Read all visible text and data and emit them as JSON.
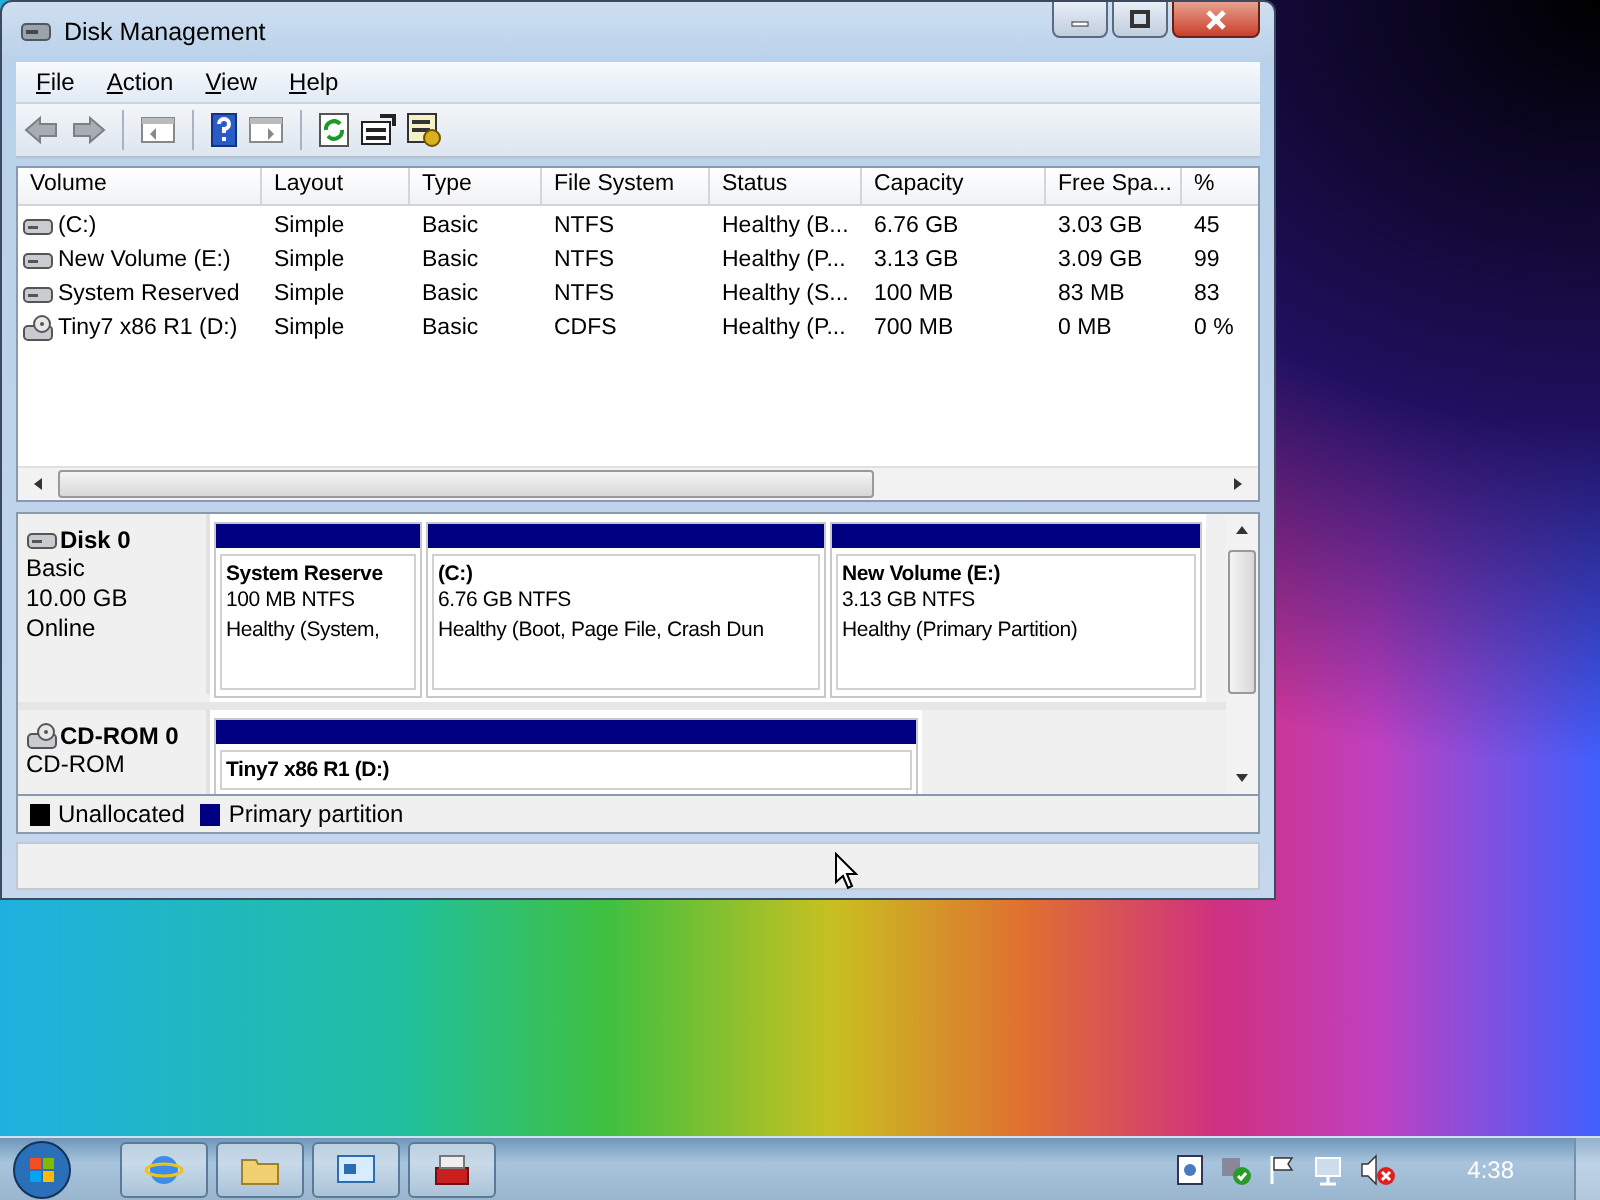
{
  "window": {
    "title": "Disk Management"
  },
  "menu": [
    {
      "label": "File"
    },
    {
      "label": "Action"
    },
    {
      "label": "View"
    },
    {
      "label": "Help"
    }
  ],
  "volume_list": {
    "columns": [
      "Volume",
      "Layout",
      "Type",
      "File System",
      "Status",
      "Capacity",
      "Free Spa...",
      "%"
    ],
    "rows": [
      {
        "kind": "hdd",
        "cells": [
          " (C:)",
          "Simple",
          "Basic",
          "NTFS",
          "Healthy (B...",
          "6.76 GB",
          "3.03 GB",
          "45"
        ]
      },
      {
        "kind": "hdd",
        "cells": [
          "New Volume (E:)",
          "Simple",
          "Basic",
          "NTFS",
          "Healthy (P...",
          "3.13 GB",
          "3.09 GB",
          "99"
        ]
      },
      {
        "kind": "hdd",
        "cells": [
          "System Reserved",
          "Simple",
          "Basic",
          "NTFS",
          "Healthy (S...",
          "100 MB",
          "83 MB",
          "83"
        ]
      },
      {
        "kind": "cdrom",
        "cells": [
          "Tiny7 x86 R1 (D:)",
          "Simple",
          "Basic",
          "CDFS",
          "Healthy (P...",
          "700 MB",
          "0 MB",
          "0 %"
        ]
      }
    ]
  },
  "disks": [
    {
      "kind": "disk",
      "name": "Disk 0",
      "lines": [
        "Basic",
        "10.00 GB",
        "Online"
      ],
      "partitions": [
        {
          "name": "System Reserve",
          "lines": [
            "100 MB NTFS",
            "Healthy (System,"
          ]
        },
        {
          "name": " (C:)",
          "lines": [
            "6.76 GB NTFS",
            "Healthy (Boot, Page File, Crash Dun"
          ]
        },
        {
          "name": "New Volume  (E:)",
          "lines": [
            "3.13 GB NTFS",
            "Healthy (Primary Partition)"
          ]
        }
      ]
    },
    {
      "kind": "cdrom",
      "name": "CD-ROM 0",
      "lines": [
        "CD-ROM"
      ],
      "partitions": [
        {
          "name": "Tiny7 x86 R1  (D:)"
        }
      ]
    }
  ],
  "legend": [
    {
      "label": "Unallocated",
      "color": "#000000"
    },
    {
      "label": "Primary partition",
      "color": "#000080"
    }
  ],
  "taskbar": {
    "clock": "4:38"
  }
}
